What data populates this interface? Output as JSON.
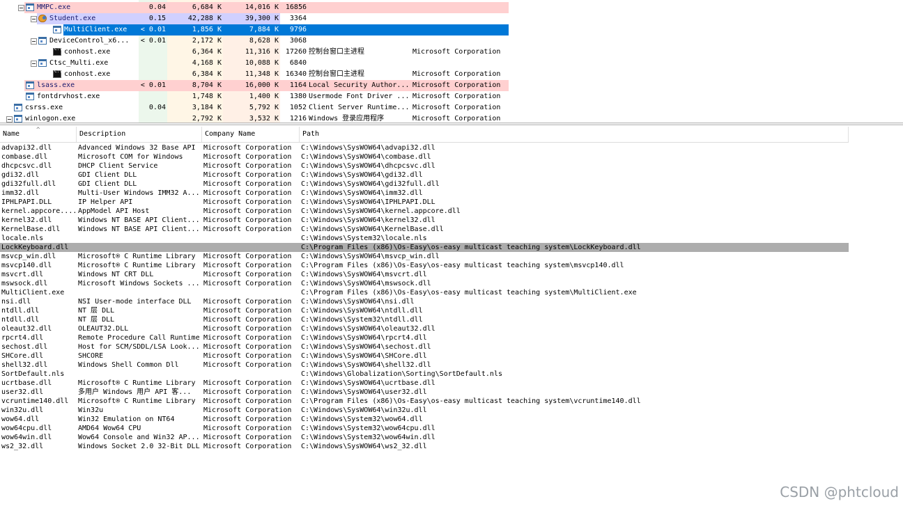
{
  "processes": [
    {
      "name": "MMPC.exe",
      "cpu": "0.04",
      "private": "6,684 K",
      "working_set": "14,016 K",
      "pid": "16856",
      "description": "",
      "company": "",
      "indent": 1,
      "icon": "window-icon",
      "expander": true
    },
    {
      "name": "Student.exe",
      "cpu": "0.15",
      "private": "42,288 K",
      "working_set": "39,300 K",
      "pid": "3364",
      "description": "",
      "company": "",
      "indent": 2,
      "icon": "user-app-icon",
      "expander": true
    },
    {
      "name": "MultiClient.exe",
      "cpu": "< 0.01",
      "private": "1,856 K",
      "working_set": "7,884 K",
      "pid": "9796",
      "description": "",
      "company": "",
      "indent": 3,
      "icon": "window-icon",
      "expander": false
    },
    {
      "name": "DeviceControl_x6...",
      "cpu": "< 0.01",
      "private": "2,172 K",
      "working_set": "8,628 K",
      "pid": "3068",
      "description": "",
      "company": "",
      "indent": 2,
      "icon": "window-icon",
      "expander": true
    },
    {
      "name": "conhost.exe",
      "cpu": "",
      "private": "6,364 K",
      "working_set": "11,316 K",
      "pid": "17260",
      "description": "控制台窗口主进程",
      "company": "Microsoft Corporation",
      "indent": 3,
      "icon": "console-icon",
      "expander": false
    },
    {
      "name": "Ctsc_Multi.exe",
      "cpu": "",
      "private": "4,168 K",
      "working_set": "10,088 K",
      "pid": "6840",
      "description": "",
      "company": "",
      "indent": 2,
      "icon": "window-icon",
      "expander": true
    },
    {
      "name": "conhost.exe",
      "cpu": "",
      "private": "6,384 K",
      "working_set": "11,348 K",
      "pid": "16340",
      "description": "控制台窗口主进程",
      "company": "Microsoft Corporation",
      "indent": 3,
      "icon": "console-icon",
      "expander": false
    },
    {
      "name": "lsass.exe",
      "cpu": "< 0.01",
      "private": "8,704 K",
      "working_set": "16,000 K",
      "pid": "1164",
      "description": "Local Security Author...",
      "company": "Microsoft Corporation",
      "indent": 1,
      "icon": "window-icon",
      "expander": false
    },
    {
      "name": "fontdrvhost.exe",
      "cpu": "",
      "private": "1,748 K",
      "working_set": "1,400 K",
      "pid": "1380",
      "description": "Usermode Font Driver ...",
      "company": "Microsoft Corporation",
      "indent": 1,
      "icon": "window-icon",
      "expander": false
    },
    {
      "name": "csrss.exe",
      "cpu": "0.04",
      "private": "3,184 K",
      "working_set": "5,792 K",
      "pid": "1052",
      "description": "Client Server Runtime...",
      "company": "Microsoft Corporation",
      "indent": 0,
      "icon": "window-icon",
      "expander": false
    },
    {
      "name": "winlogon.exe",
      "cpu": "",
      "private": "2,792 K",
      "working_set": "3,532 K",
      "pid": "1216",
      "description": "Windows 登录应用程序",
      "company": "Microsoft Corporation",
      "indent": 0,
      "icon": "window-icon",
      "expander": true
    }
  ],
  "dll_columns": {
    "name": "Name",
    "description": "Description",
    "company": "Company Name",
    "path": "Path"
  },
  "dlls": [
    {
      "name": "advapi32.dll",
      "description": "Advanced Windows 32 Base API",
      "company": "Microsoft Corporation",
      "path": "C:\\Windows\\SysWOW64\\advapi32.dll"
    },
    {
      "name": "combase.dll",
      "description": "Microsoft COM for Windows",
      "company": "Microsoft Corporation",
      "path": "C:\\Windows\\SysWOW64\\combase.dll"
    },
    {
      "name": "dhcpcsvc.dll",
      "description": "DHCP Client Service",
      "company": "Microsoft Corporation",
      "path": "C:\\Windows\\SysWOW64\\dhcpcsvc.dll"
    },
    {
      "name": "gdi32.dll",
      "description": "GDI Client DLL",
      "company": "Microsoft Corporation",
      "path": "C:\\Windows\\SysWOW64\\gdi32.dll"
    },
    {
      "name": "gdi32full.dll",
      "description": "GDI Client DLL",
      "company": "Microsoft Corporation",
      "path": "C:\\Windows\\SysWOW64\\gdi32full.dll"
    },
    {
      "name": "imm32.dll",
      "description": "Multi-User Windows IMM32 A...",
      "company": "Microsoft Corporation",
      "path": "C:\\Windows\\SysWOW64\\imm32.dll"
    },
    {
      "name": "IPHLPAPI.DLL",
      "description": "IP Helper API",
      "company": "Microsoft Corporation",
      "path": "C:\\Windows\\SysWOW64\\IPHLPAPI.DLL"
    },
    {
      "name": "kernel.appcore....",
      "description": "AppModel API Host",
      "company": "Microsoft Corporation",
      "path": "C:\\Windows\\SysWOW64\\kernel.appcore.dll"
    },
    {
      "name": "kernel32.dll",
      "description": "Windows NT BASE API Client...",
      "company": "Microsoft Corporation",
      "path": "C:\\Windows\\SysWOW64\\kernel32.dll"
    },
    {
      "name": "KernelBase.dll",
      "description": "Windows NT BASE API Client...",
      "company": "Microsoft Corporation",
      "path": "C:\\Windows\\SysWOW64\\KernelBase.dll"
    },
    {
      "name": "locale.nls",
      "description": "",
      "company": "",
      "path": "C:\\Windows\\System32\\locale.nls"
    },
    {
      "name": "LockKeyboard.dll",
      "description": "",
      "company": "",
      "path": "C:\\Program Files (x86)\\Os-Easy\\os-easy multicast teaching system\\LockKeyboard.dll"
    },
    {
      "name": "msvcp_win.dll",
      "description": "Microsoft® C Runtime Library",
      "company": "Microsoft Corporation",
      "path": "C:\\Windows\\SysWOW64\\msvcp_win.dll"
    },
    {
      "name": "msvcp140.dll",
      "description": "Microsoft® C Runtime Library",
      "company": "Microsoft Corporation",
      "path": "C:\\Program Files (x86)\\Os-Easy\\os-easy multicast teaching system\\msvcp140.dll"
    },
    {
      "name": "msvcrt.dll",
      "description": "Windows NT CRT DLL",
      "company": "Microsoft Corporation",
      "path": "C:\\Windows\\SysWOW64\\msvcrt.dll"
    },
    {
      "name": "mswsock.dll",
      "description": "Microsoft Windows Sockets ...",
      "company": "Microsoft Corporation",
      "path": "C:\\Windows\\SysWOW64\\mswsock.dll"
    },
    {
      "name": "MultiClient.exe",
      "description": "",
      "company": "",
      "path": "C:\\Program Files (x86)\\Os-Easy\\os-easy multicast teaching system\\MultiClient.exe"
    },
    {
      "name": "nsi.dll",
      "description": "NSI User-mode interface DLL",
      "company": "Microsoft Corporation",
      "path": "C:\\Windows\\SysWOW64\\nsi.dll"
    },
    {
      "name": "ntdll.dll",
      "description": "NT 层 DLL",
      "company": "Microsoft Corporation",
      "path": "C:\\Windows\\SysWOW64\\ntdll.dll"
    },
    {
      "name": "ntdll.dll",
      "description": "NT 层 DLL",
      "company": "Microsoft Corporation",
      "path": "C:\\Windows\\System32\\ntdll.dll"
    },
    {
      "name": "oleaut32.dll",
      "description": "OLEAUT32.DLL",
      "company": "Microsoft Corporation",
      "path": "C:\\Windows\\SysWOW64\\oleaut32.dll"
    },
    {
      "name": "rpcrt4.dll",
      "description": "Remote Procedure Call Runtime",
      "company": "Microsoft Corporation",
      "path": "C:\\Windows\\SysWOW64\\rpcrt4.dll"
    },
    {
      "name": "sechost.dll",
      "description": "Host for SCM/SDDL/LSA Look...",
      "company": "Microsoft Corporation",
      "path": "C:\\Windows\\SysWOW64\\sechost.dll"
    },
    {
      "name": "SHCore.dll",
      "description": "SHCORE",
      "company": "Microsoft Corporation",
      "path": "C:\\Windows\\SysWOW64\\SHCore.dll"
    },
    {
      "name": "shell32.dll",
      "description": "Windows Shell Common Dll",
      "company": "Microsoft Corporation",
      "path": "C:\\Windows\\SysWOW64\\shell32.dll"
    },
    {
      "name": "SortDefault.nls",
      "description": "",
      "company": "",
      "path": "C:\\Windows\\Globalization\\Sorting\\SortDefault.nls"
    },
    {
      "name": "ucrtbase.dll",
      "description": "Microsoft® C Runtime Library",
      "company": "Microsoft Corporation",
      "path": "C:\\Windows\\SysWOW64\\ucrtbase.dll"
    },
    {
      "name": "user32.dll",
      "description": "多用户 Windows 用户 API 客...",
      "company": "Microsoft Corporation",
      "path": "C:\\Windows\\SysWOW64\\user32.dll"
    },
    {
      "name": "vcruntime140.dll",
      "description": "Microsoft® C Runtime Library",
      "company": "Microsoft Corporation",
      "path": "C:\\Program Files (x86)\\Os-Easy\\os-easy multicast teaching system\\vcruntime140.dll"
    },
    {
      "name": "win32u.dll",
      "description": "Win32u",
      "company": "Microsoft Corporation",
      "path": "C:\\Windows\\SysWOW64\\win32u.dll"
    },
    {
      "name": "wow64.dll",
      "description": "Win32 Emulation on NT64",
      "company": "Microsoft Corporation",
      "path": "C:\\Windows\\System32\\wow64.dll"
    },
    {
      "name": "wow64cpu.dll",
      "description": "AMD64 Wow64 CPU",
      "company": "Microsoft Corporation",
      "path": "C:\\Windows\\System32\\wow64cpu.dll"
    },
    {
      "name": "wow64win.dll",
      "description": "Wow64 Console and Win32 AP...",
      "company": "Microsoft Corporation",
      "path": "C:\\Windows\\System32\\wow64win.dll"
    },
    {
      "name": "ws2_32.dll",
      "description": "Windows Socket 2.0 32-Bit DLL",
      "company": "Microsoft Corporation",
      "path": "C:\\Windows\\SysWOW64\\ws2_32.dll"
    }
  ],
  "selected_dll_index": 11,
  "selected_process_index": 2,
  "watermark": "CSDN @phtcloud",
  "colors": {
    "selected_process": "#0078d7",
    "highlight_pink": "#ffd0d0",
    "highlight_lavender": "#d0d0ff",
    "selected_dll": "#adadad",
    "col_cpu_bg": "#ecf7ec",
    "col_private_bg": "#fff6e6",
    "col_ws_bg": "#fff0e6"
  }
}
